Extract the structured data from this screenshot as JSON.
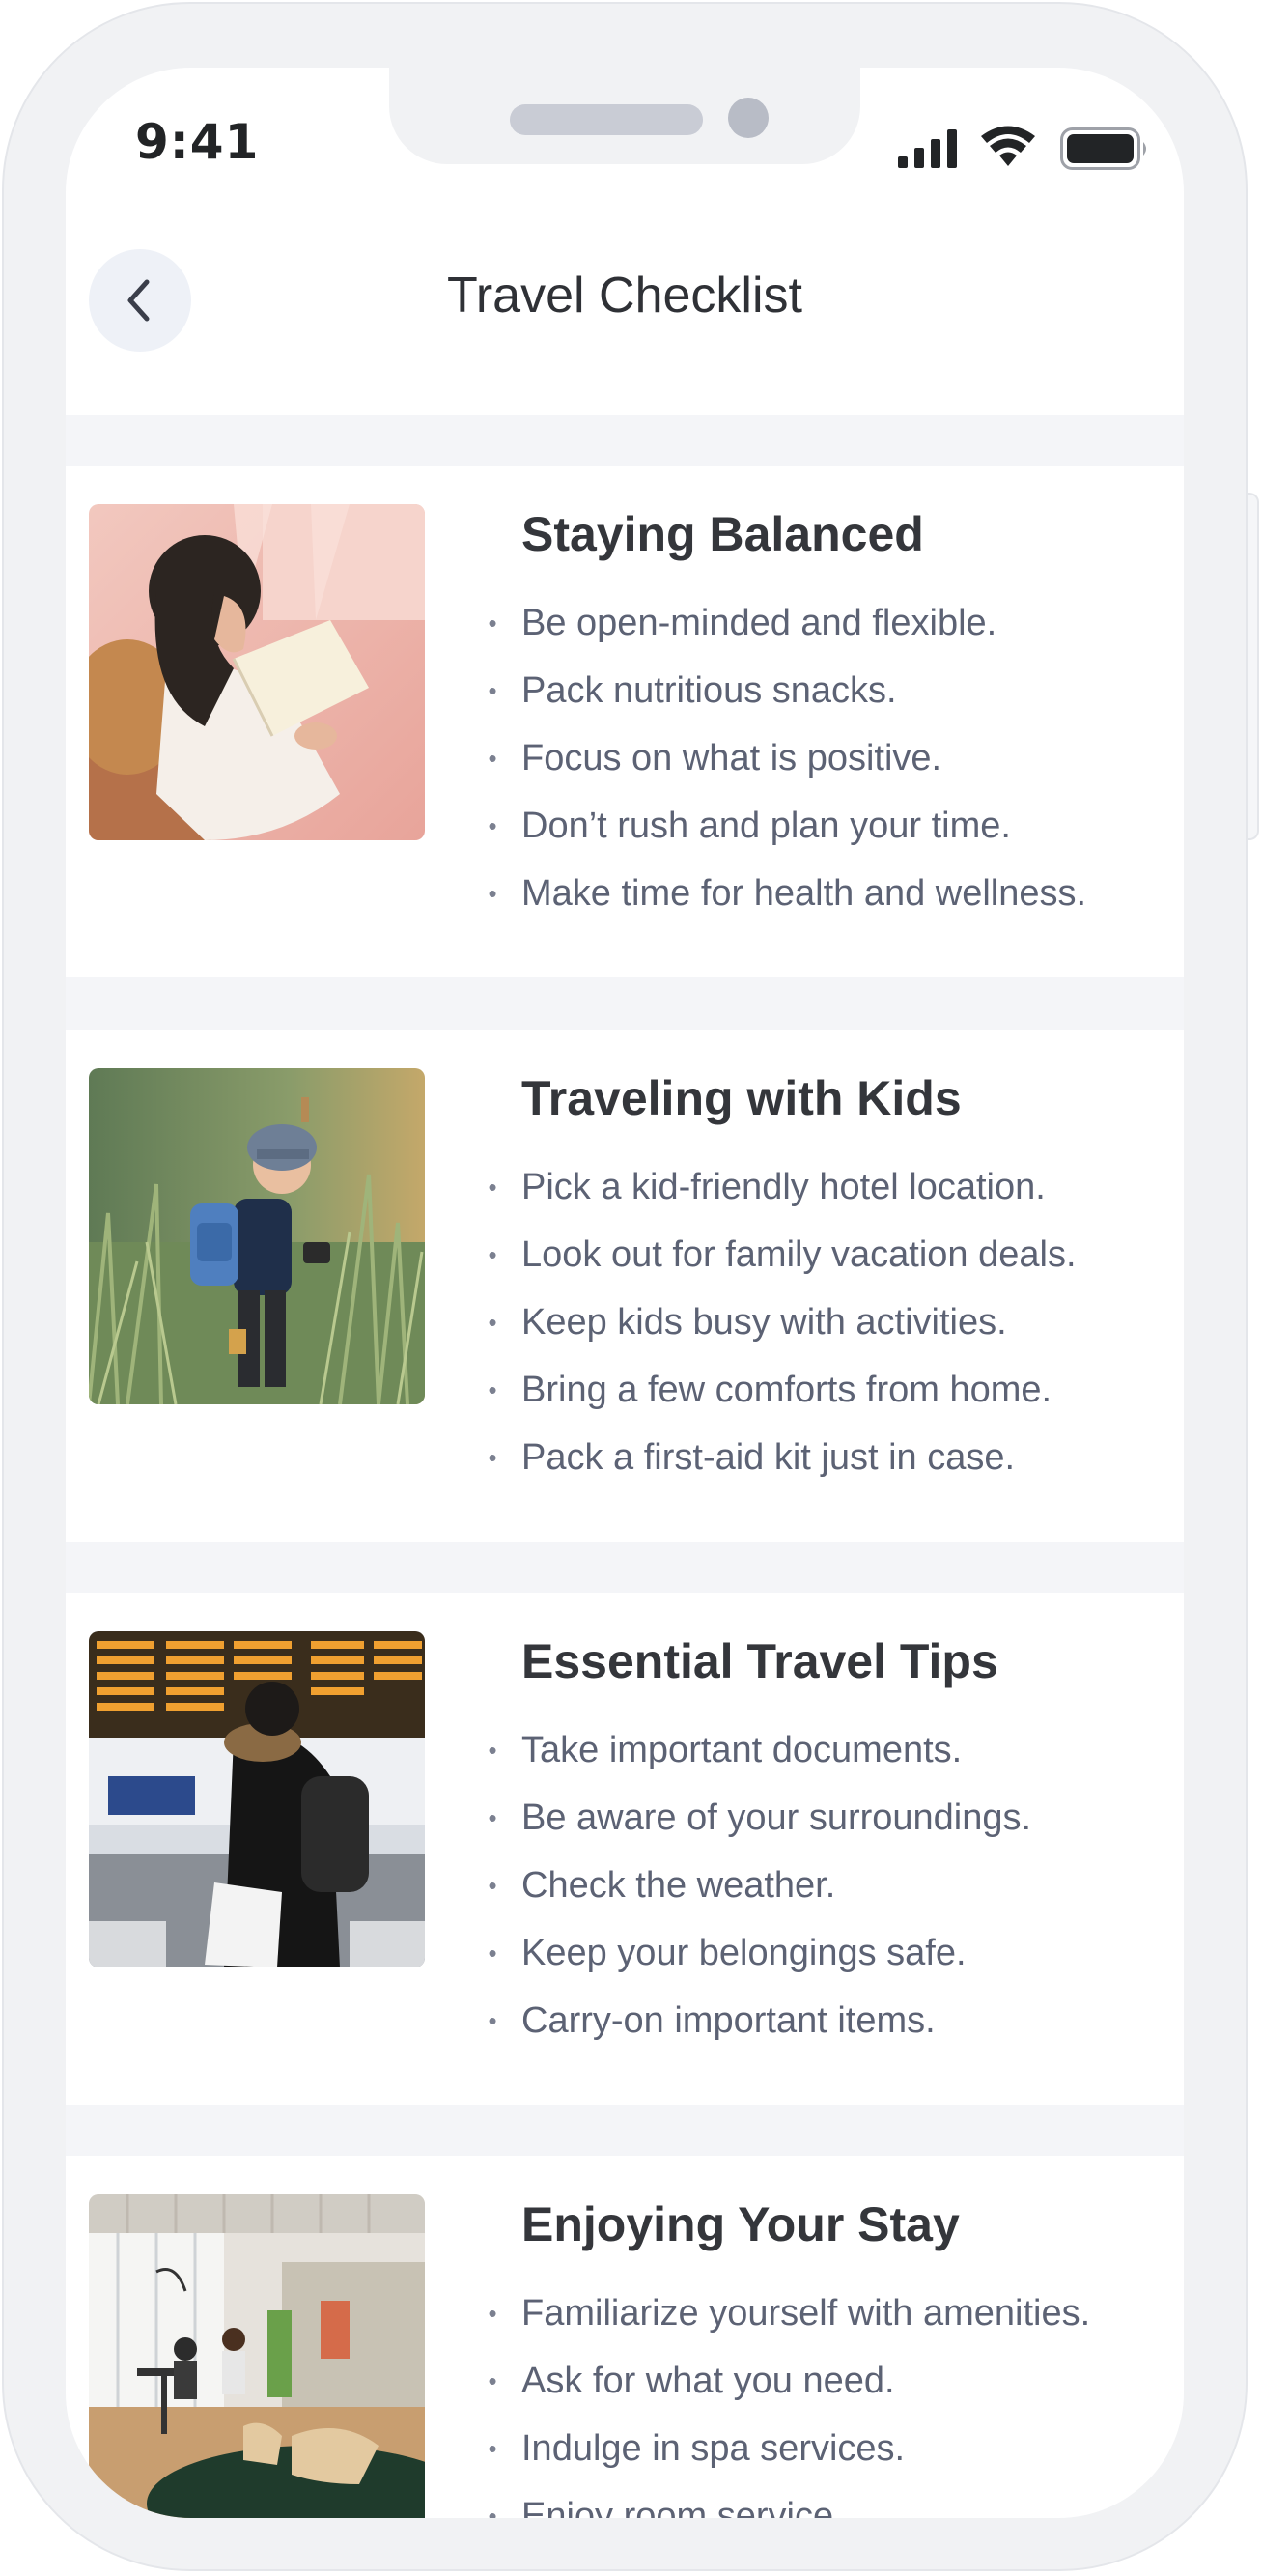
{
  "status_bar": {
    "time": "9:41",
    "icons": [
      "signal-icon",
      "wifi-icon",
      "battery-icon"
    ]
  },
  "header": {
    "title": "Travel Checklist",
    "back_icon": "chevron-left-icon"
  },
  "sections": [
    {
      "title": "Staying Balanced",
      "image": "woman-reading-book-image",
      "items": [
        "Be open-minded and flexible.",
        "Pack nutritious snacks.",
        "Focus on what is positive.",
        "Don’t rush and plan your time.",
        "Make time for health and wellness."
      ]
    },
    {
      "title": "Traveling with Kids",
      "image": "child-with-backpack-in-field-image",
      "items": [
        "Pick a kid-friendly hotel location.",
        "Look out for family vacation deals.",
        "Keep kids busy with activities.",
        "Bring a few comforts from home.",
        "Pack a first-aid kit just in case."
      ]
    },
    {
      "title": "Essential Travel Tips",
      "image": "traveler-at-departure-board-image",
      "items": [
        "Take important documents.",
        "Be aware of your surroundings.",
        "Check the weather.",
        "Keep your belongings safe.",
        "Carry-on important items."
      ]
    },
    {
      "title": "Enjoying Your Stay",
      "image": "hotel-lobby-image",
      "items": [
        "Familiarize yourself with amenities.",
        "Ask for what you need.",
        "Indulge in spa services.",
        "Enjoy room service."
      ]
    }
  ],
  "colors": {
    "background": "#f4f5f8",
    "card": "#ffffff",
    "title": "#34363b",
    "body_text": "#5c6274",
    "back_button_bg": "#eef1f7"
  }
}
